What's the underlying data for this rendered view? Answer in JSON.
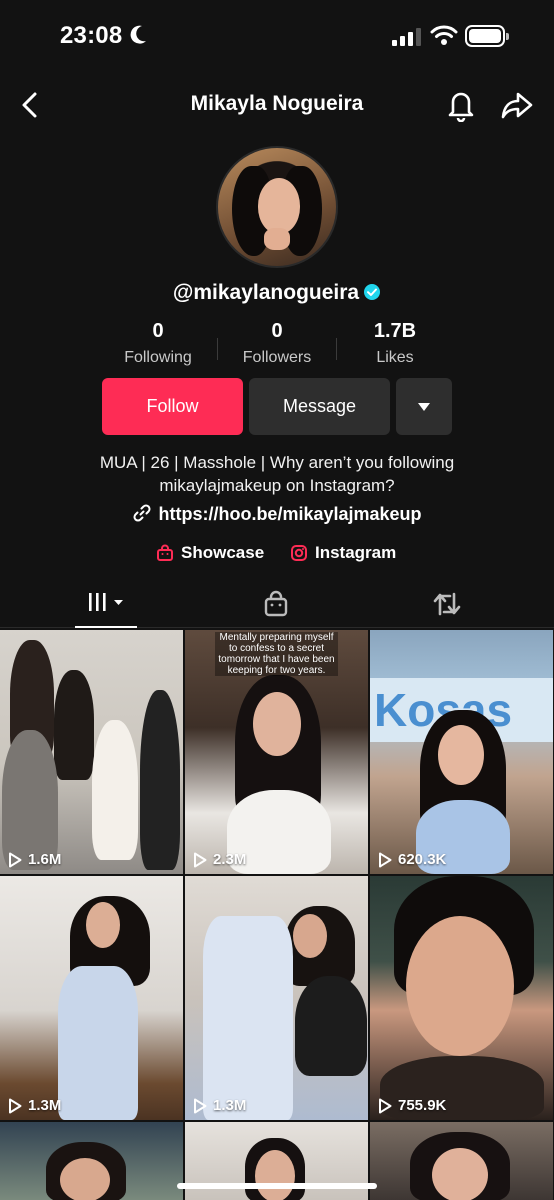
{
  "status_bar": {
    "time": "23:08"
  },
  "header": {
    "title": "Mikayla Nogueira"
  },
  "profile": {
    "username": "@mikaylanogueira",
    "stats": [
      {
        "value": "0",
        "label": "Following"
      },
      {
        "value": "0",
        "label": "Followers"
      },
      {
        "value": "1.7B",
        "label": "Likes"
      }
    ],
    "follow_label": "Follow",
    "message_label": "Message",
    "bio_line1": "MUA | 26 | Masshole | Why aren’t you following",
    "bio_line2": "mikaylajmakeup on Instagram?",
    "link": "https://hoo.be/mikaylajmakeup",
    "showcase_label": "Showcase",
    "instagram_label": "Instagram"
  },
  "videos": [
    {
      "views": "1.6M"
    },
    {
      "views": "2.3M",
      "caption": "Mentally preparing myself to confess to a secret tomorrow that I have been keeping for two years."
    },
    {
      "views": "620.3K"
    },
    {
      "views": "1.3M"
    },
    {
      "views": "1.3M"
    },
    {
      "views": "755.9K"
    }
  ],
  "colors": {
    "accent": "#fe2c55",
    "background": "#121212",
    "verified": "#20d5ec"
  }
}
